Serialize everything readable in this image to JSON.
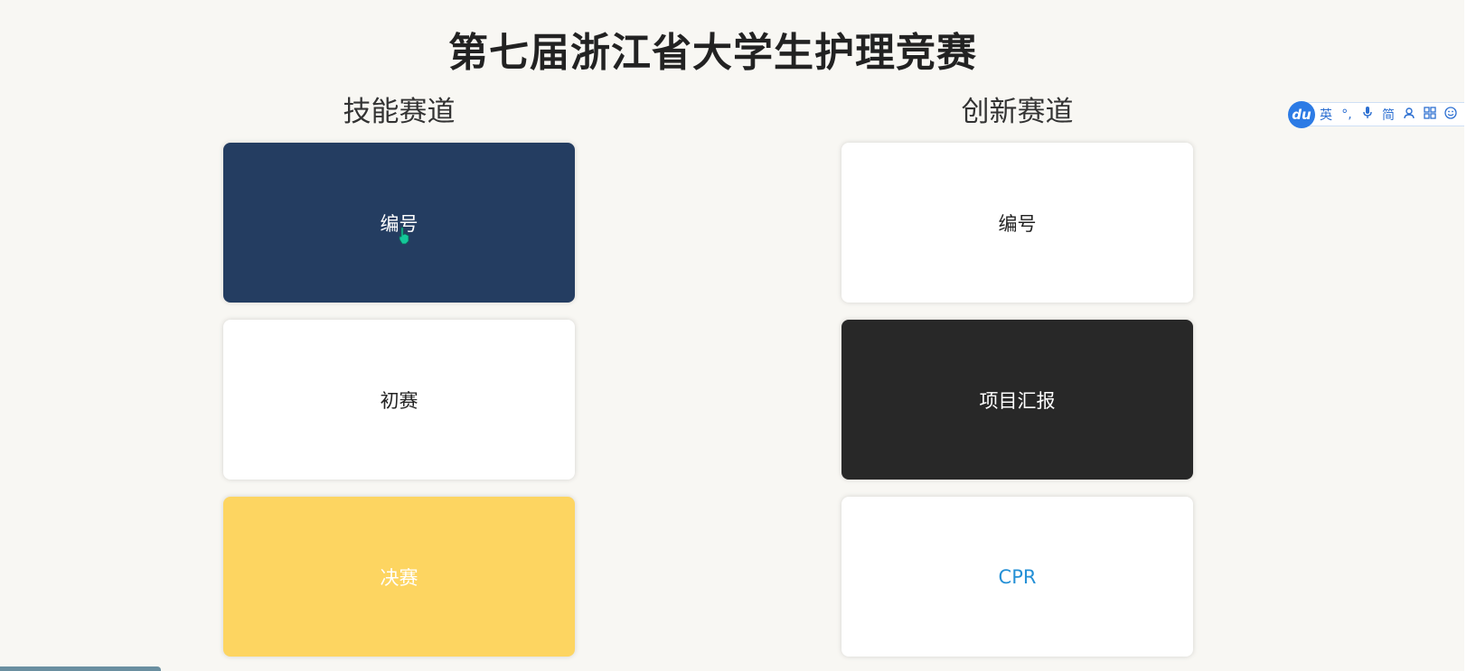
{
  "page": {
    "title": "第七届浙江省大学生护理竞赛"
  },
  "tracks": [
    {
      "title": "技能赛道",
      "cards": [
        {
          "label": "编号",
          "style": "navy",
          "color": "#243d61"
        },
        {
          "label": "初赛",
          "style": "white",
          "color": "#ffffff"
        },
        {
          "label": "决赛",
          "style": "yellow",
          "color": "#fdd561"
        }
      ]
    },
    {
      "title": "创新赛道",
      "cards": [
        {
          "label": "编号",
          "style": "white",
          "color": "#ffffff"
        },
        {
          "label": "项目汇报",
          "style": "black",
          "color": "#282828"
        },
        {
          "label": "CPR",
          "style": "white",
          "color": "#ffffff",
          "text_color": "#2590d6"
        }
      ]
    }
  ],
  "ime_toolbar": {
    "logo": "du",
    "items": [
      {
        "label": "英",
        "icon": "english-mode-icon"
      },
      {
        "label": "°,",
        "icon": "punctuation-icon"
      },
      {
        "label": "🎤",
        "icon": "microphone-icon"
      },
      {
        "label": "简",
        "icon": "simplified-chinese-icon"
      },
      {
        "label": "♙",
        "icon": "user-icon"
      },
      {
        "label": "▦",
        "icon": "grid-icon"
      },
      {
        "label": "☺",
        "icon": "emoji-icon"
      }
    ]
  }
}
